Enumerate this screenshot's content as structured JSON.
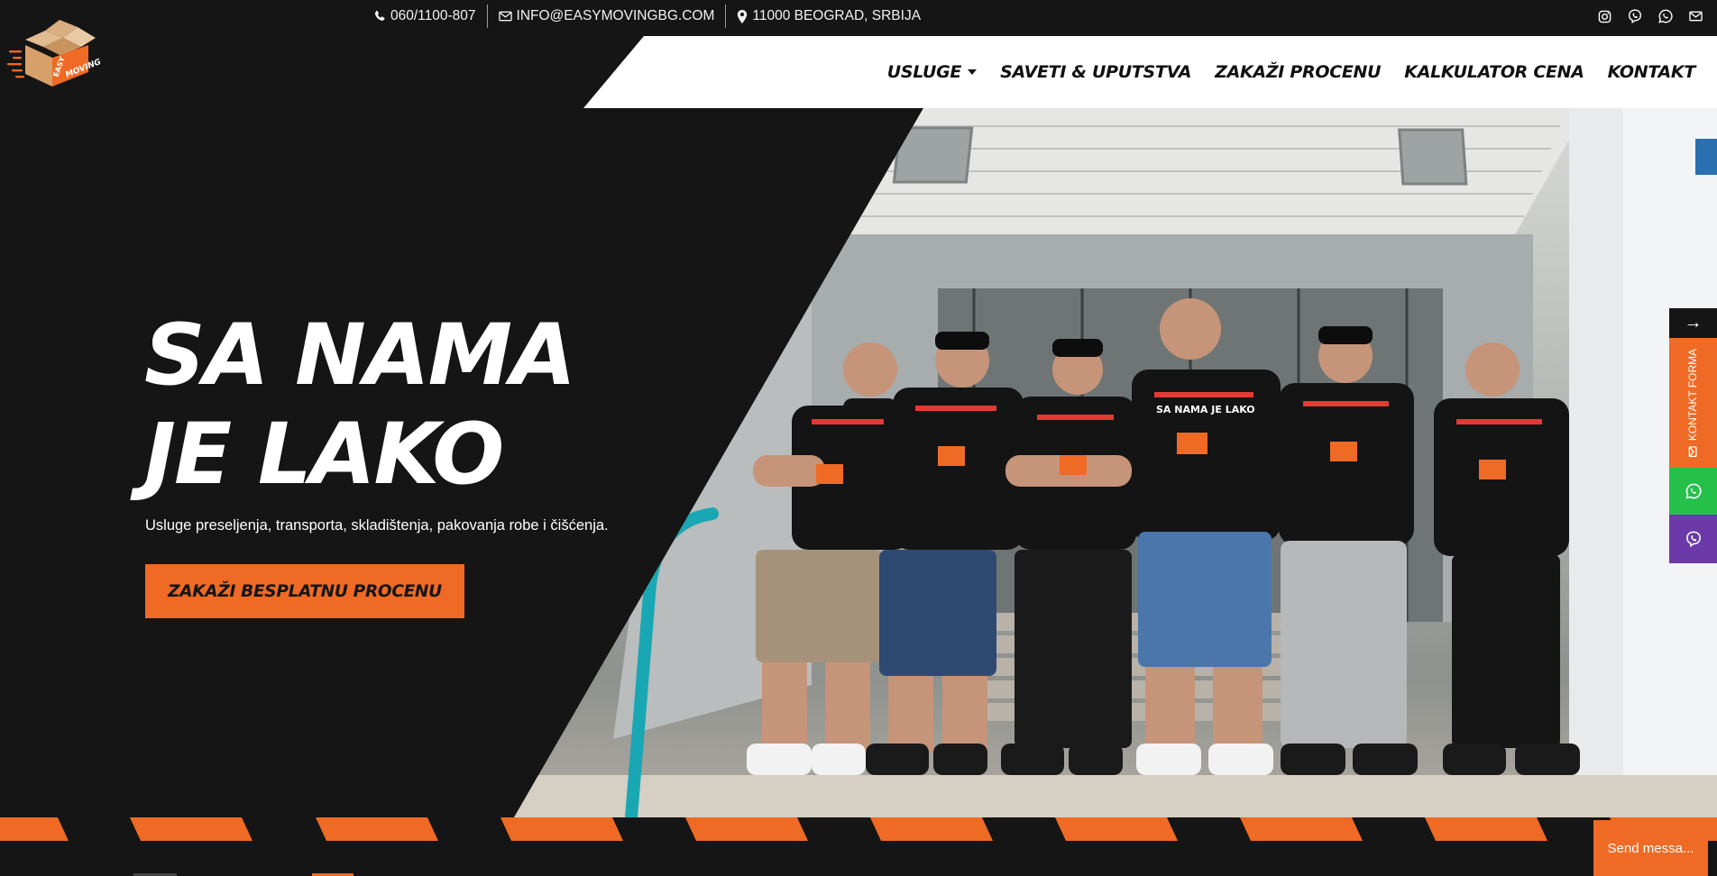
{
  "topbar": {
    "phone": "060/1100-807",
    "email": "INFO@EASYMOVINGBG.COM",
    "address": "11000 BEOGRAD, SRBIJA",
    "social_icons": [
      "instagram-icon",
      "viber-icon",
      "whatsapp-icon",
      "email-icon"
    ]
  },
  "logo": {
    "text_easy": "EASY",
    "text_moving": "MOVING"
  },
  "nav": {
    "items": [
      {
        "label": "USLUGE",
        "has_dropdown": true
      },
      {
        "label": "SAVETI & UPUTSTVA"
      },
      {
        "label": "ZAKAŽI PROCENU"
      },
      {
        "label": "KALKULATOR CENA"
      },
      {
        "label": "KONTAKT"
      }
    ]
  },
  "hero": {
    "title_line1": "SA NAMA",
    "title_line2": "JE LAKO",
    "subtitle": "Usluge preseljenja, transporta, skladištenja, pakovanja robe i čišćenja.",
    "cta_label": "ZAKAŽI BESPLATNU PROCENU",
    "photo_shirt_text": "SA NAMA JE LAKO"
  },
  "side_widgets": {
    "arrow": "→",
    "contact_form_label": "KONTAKT FORMA"
  },
  "chat": {
    "send_message_label": "Send messa..."
  },
  "colors": {
    "accent": "#ef6a24",
    "dark": "#151515",
    "white": "#ffffff",
    "whatsapp": "#25c04a",
    "viber": "#6c3aa8"
  }
}
